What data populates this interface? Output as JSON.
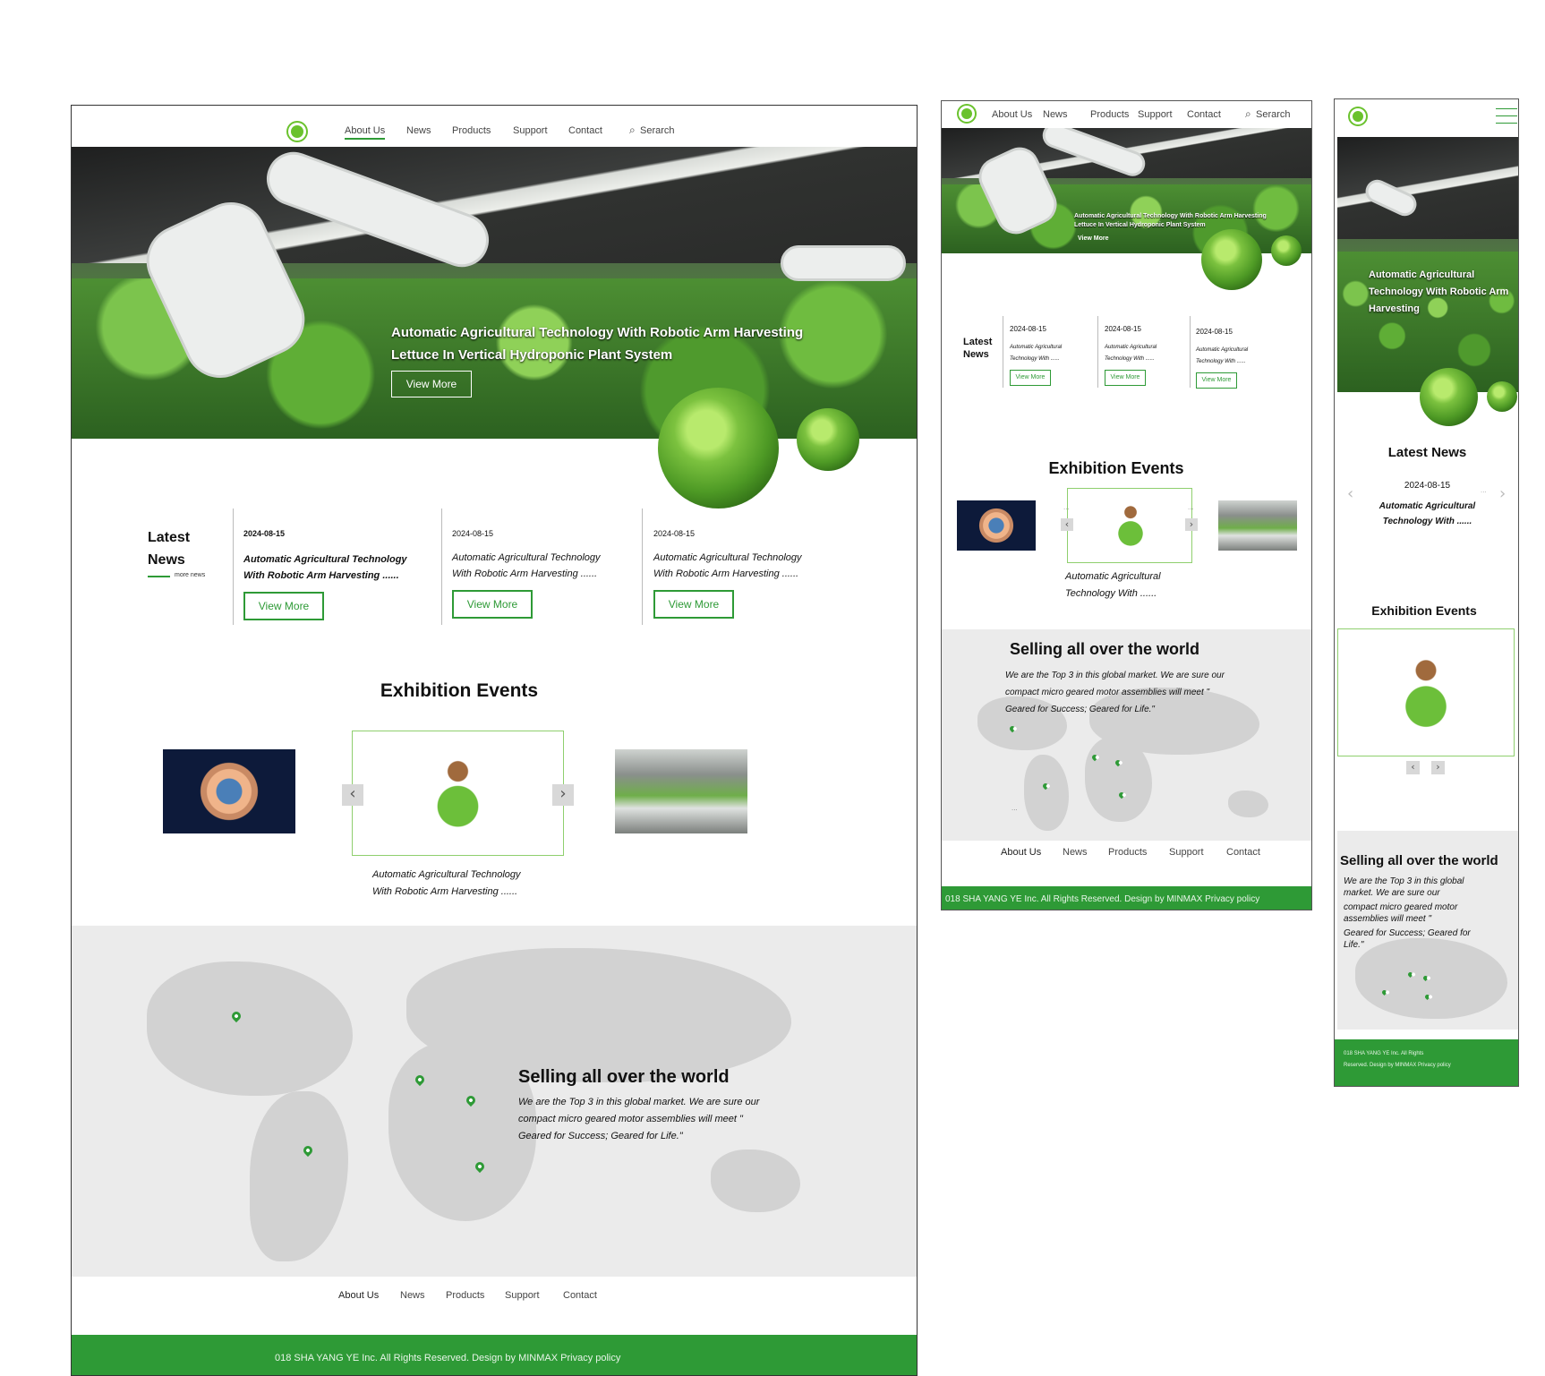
{
  "nav": {
    "about": "About Us",
    "news": "News",
    "products": "Products",
    "support": "Support",
    "contact": "Contact",
    "search": "Serarch"
  },
  "hero": {
    "title_line1": "Automatic Agricultural Technology With Robotic Arm Harvesting",
    "title_line2": "Lettuce In Vertical Hydroponic Plant System",
    "cta": "View More",
    "mobile_title": "Automatic Agricultural Technology With Robotic Arm Harvesting"
  },
  "latest_news": {
    "heading_line1": "Latest",
    "heading_line2": "News",
    "heading_mobile": "Latest News",
    "more": "more news",
    "items": [
      {
        "date": "2024-08-15",
        "title": "Automatic Agricultural Technology",
        "title2": "With Robotic Arm Harvesting ......",
        "cta": "View More"
      },
      {
        "date": "2024-08-15",
        "title": "Automatic Agricultural Technology",
        "title2": "With Robotic Arm Harvesting ......",
        "cta": "View More"
      },
      {
        "date": "2024-08-15",
        "title": "Automatic Agricultural Technology",
        "title2": "With Robotic Arm Harvesting ......",
        "cta": "View More"
      }
    ],
    "short_title1": "Automatic Agricultural",
    "short_title2": "Technology With ......"
  },
  "exhibition": {
    "heading": "Exhibition Events",
    "caption1": "Automatic Agricultural Technology",
    "caption2": "With Robotic Arm Harvesting ......",
    "short_caption1": "Automatic Agricultural",
    "short_caption2": "Technology With ......",
    "prev": "‹",
    "next": "›",
    "ellipsis": "..."
  },
  "world": {
    "heading": "Selling all over the world",
    "line1": "We are the Top 3 in this global market. We are sure our",
    "line2": "compact micro geared motor assemblies will meet \"",
    "line3": "Geared for Success; Geared for Life.\"",
    "m_line1": "We are the Top 3 in this global",
    "m_line2": "market. We are sure our",
    "m_line3": "compact micro geared motor",
    "m_line4": "assemblies will meet \"",
    "m_line5": "Geared for Success; Geared for",
    "m_line6": "Life.\""
  },
  "footer": {
    "copyright": "018 SHA YANG YE Inc. All Rights Reserved. Design by MINMAX Privacy policy",
    "m_copy1": "018 SHA YANG YE Inc. All Rights",
    "m_copy2": "Reserved. Design by MINMAX Privacy policy"
  },
  "colors": {
    "accent": "#2e9a36",
    "gray_bg": "#ebebeb"
  }
}
